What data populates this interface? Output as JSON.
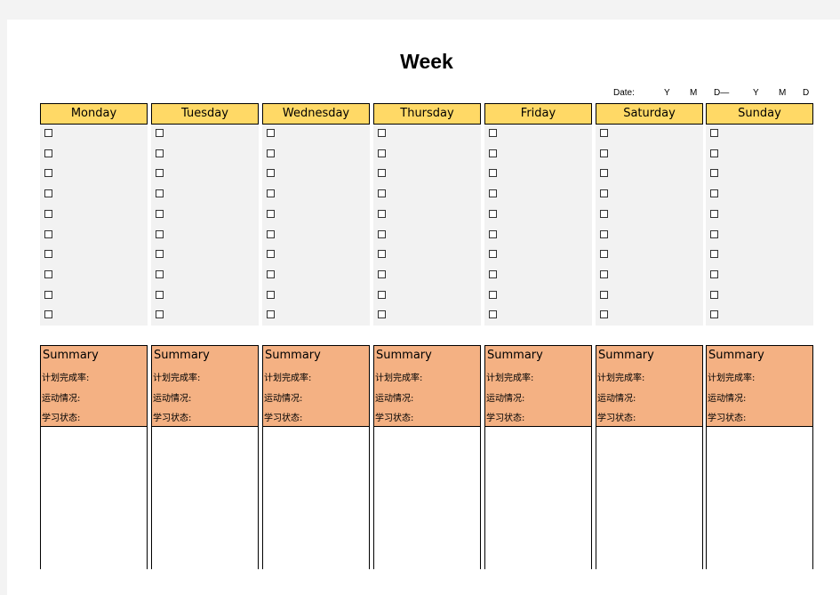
{
  "title": "Week",
  "date": {
    "label": "Date:",
    "y1": "Y",
    "m1": "M",
    "d1": "D—",
    "y2": "Y",
    "m2": "M",
    "d2": "D"
  },
  "days": [
    "Monday",
    "Tuesday",
    "Wednesday",
    "Thursday",
    "Friday",
    "Saturday",
    "Sunday"
  ],
  "checkboxes_per_day": 10,
  "summary": {
    "heading": "Summary",
    "lines": [
      "计划完成率:",
      "运动情况:",
      "学习状态:"
    ]
  },
  "colors": {
    "header": "#ffd966",
    "summary": "#f4b183",
    "task_bg": "#f2f2f2"
  }
}
